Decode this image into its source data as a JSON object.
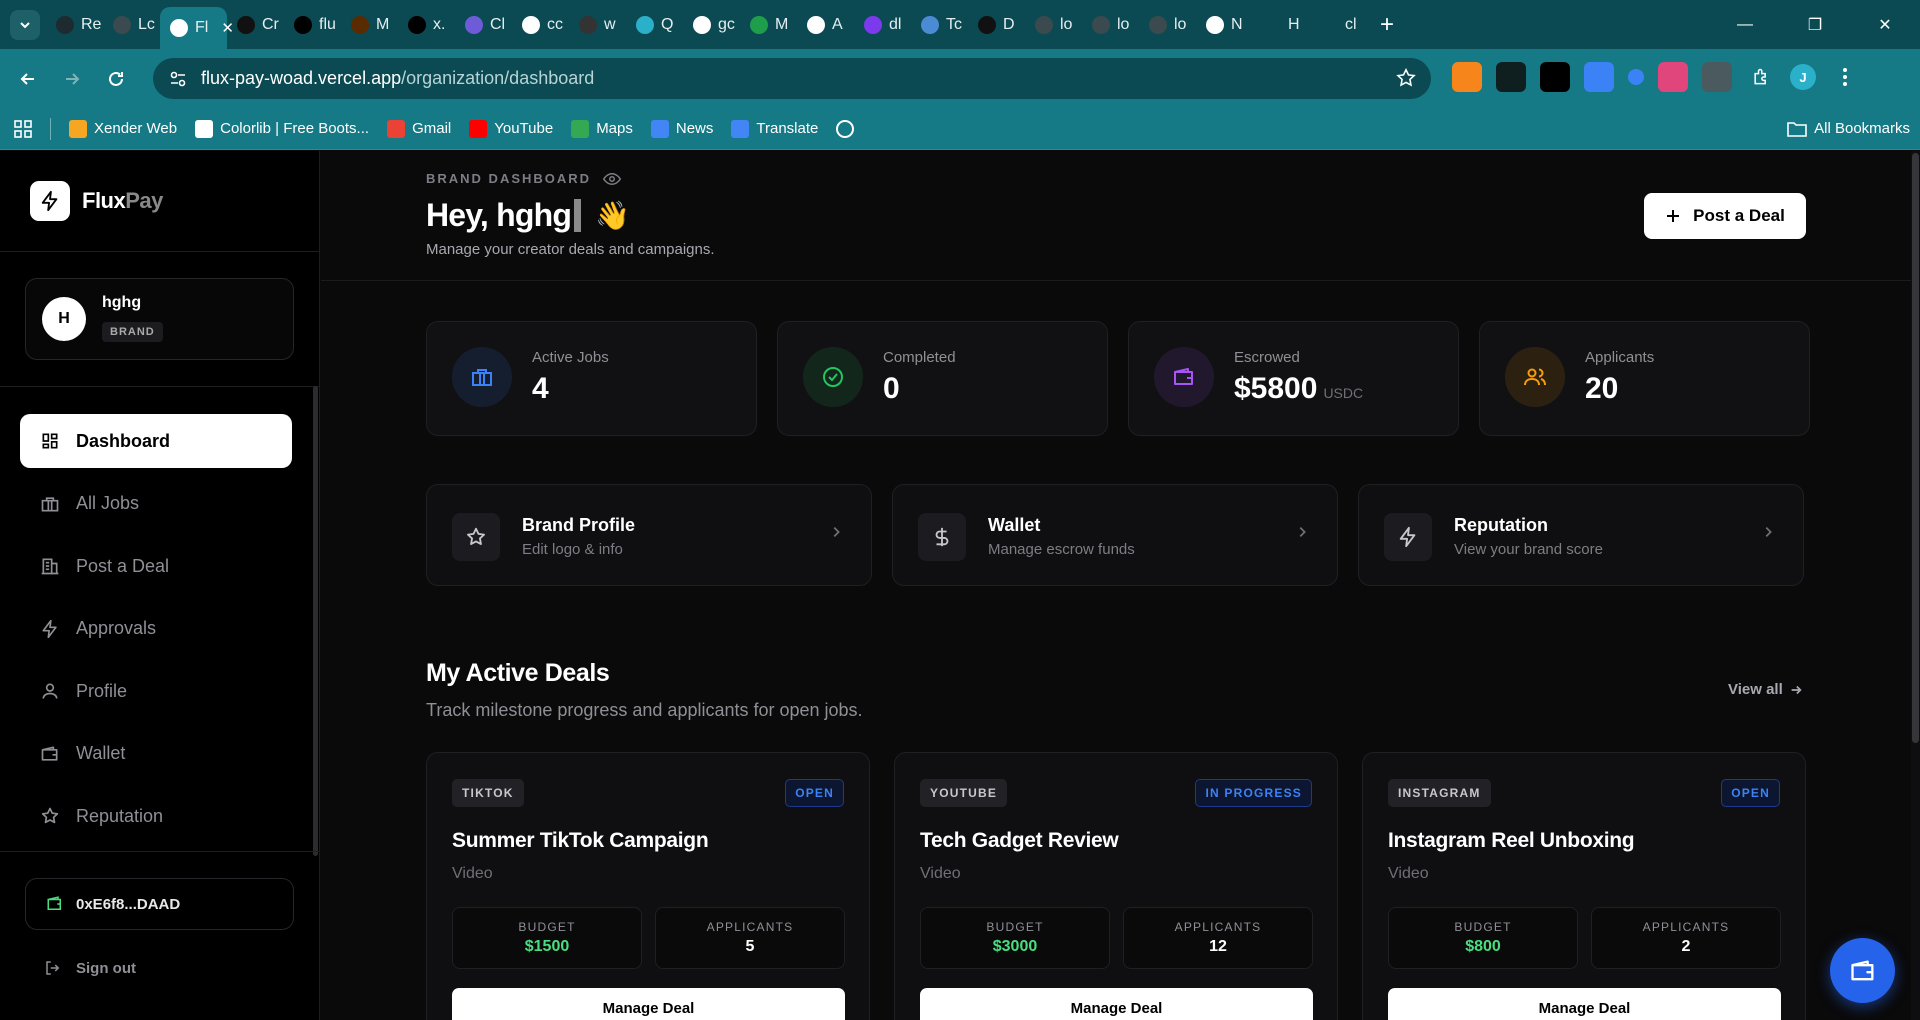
{
  "browser": {
    "tabs": [
      {
        "label": "Re",
        "icon": "react-icon",
        "color": "#1d2b30"
      },
      {
        "label": "Lc",
        "icon": "globe-icon",
        "color": "#3a4a4e"
      },
      {
        "label": "Fl",
        "icon": "flux-icon",
        "color": "#ffffff",
        "active": true
      },
      {
        "label": "Cr",
        "icon": "github-icon",
        "color": "#111111"
      },
      {
        "label": "flu",
        "icon": "vercel-icon",
        "color": "#000000"
      },
      {
        "label": "M",
        "icon": "metamask-icon",
        "color": "#5a2a00"
      },
      {
        "label": "x.",
        "icon": "x-icon",
        "color": "#000000"
      },
      {
        "label": "Cl",
        "icon": "claude-icon",
        "color": "#6e5bd8"
      },
      {
        "label": "cc",
        "icon": "notion-icon",
        "color": "#ffffff"
      },
      {
        "label": "w",
        "icon": "camera-icon",
        "color": "#333333"
      },
      {
        "label": "Q",
        "icon": "q-icon",
        "color": "#2bb0c9"
      },
      {
        "label": "gc",
        "icon": "gemini-icon",
        "color": "#ffffff"
      },
      {
        "label": "M",
        "icon": "meet-icon",
        "color": "#1e9e4a"
      },
      {
        "label": "A",
        "icon": "a-icon",
        "color": "#ffffff"
      },
      {
        "label": "dl",
        "icon": "d-icon",
        "color": "#7c3aed"
      },
      {
        "label": "Tc",
        "icon": "t-icon",
        "color": "#4b8bd4"
      },
      {
        "label": "D",
        "icon": "github-icon",
        "color": "#111111"
      },
      {
        "label": "lo",
        "icon": "globe-icon",
        "color": "#3a4a4e"
      },
      {
        "label": "lo",
        "icon": "globe-icon",
        "color": "#3a4a4e"
      },
      {
        "label": "lo",
        "icon": "globe-icon",
        "color": "#3a4a4e"
      },
      {
        "label": "N",
        "icon": "chrome-icon",
        "color": "#ffffff"
      },
      {
        "label": "H",
        "icon": "history-icon",
        "color": "#0b4a52"
      },
      {
        "label": "cl",
        "icon": "claude-spark-icon",
        "color": "#0b4a52"
      }
    ],
    "close_tab": "✕",
    "new_tab": "+",
    "window_controls": {
      "minimize": "—",
      "restore": "❐",
      "close": "✕"
    },
    "url_host": "flux-pay-woad.vercel.app",
    "url_path": "/organization/dashboard",
    "extensions": [
      "metamask-icon",
      "terminal-icon",
      "x-icon",
      "cloud-icon",
      "circle-icon",
      "figma-icon",
      "bot-icon",
      "puzzle-icon",
      "profile-icon",
      "menu-icon"
    ],
    "profile_initial": "J",
    "bookmarks": [
      {
        "label": "Xender Web",
        "icon": "xender-icon",
        "color": "#f5a623"
      },
      {
        "label": "Colorlib | Free Boots...",
        "icon": "globe-icon",
        "color": "#ffffff"
      },
      {
        "label": "Gmail",
        "icon": "gmail-icon",
        "color": "#ea4335"
      },
      {
        "label": "YouTube",
        "icon": "youtube-icon",
        "color": "#ff0000"
      },
      {
        "label": "Maps",
        "icon": "maps-icon",
        "color": "#34a853"
      },
      {
        "label": "News",
        "icon": "news-icon",
        "color": "#4285f4"
      },
      {
        "label": "Translate",
        "icon": "translate-icon",
        "color": "#4285f4"
      }
    ],
    "all_bookmarks": "All Bookmarks"
  },
  "sidebar": {
    "logo_flux": "Flux",
    "logo_pay": "Pay",
    "user_initial": "H",
    "user_name": "hghg",
    "user_role": "BRAND",
    "items": [
      {
        "label": "Dashboard",
        "icon": "dashboard-icon",
        "active": true
      },
      {
        "label": "All Jobs",
        "icon": "briefcase-icon"
      },
      {
        "label": "Post a Deal",
        "icon": "building-icon"
      },
      {
        "label": "Approvals",
        "icon": "bolt-icon"
      },
      {
        "label": "Profile",
        "icon": "user-icon"
      },
      {
        "label": "Wallet",
        "icon": "wallet-icon"
      },
      {
        "label": "Reputation",
        "icon": "star-icon"
      }
    ],
    "wallet_address": "0xE6f8...DAAD",
    "sign_out": "Sign out"
  },
  "header": {
    "eyebrow": "BRAND DASHBOARD",
    "greeting": "Hey, hghg",
    "wave": "👋",
    "subtitle": "Manage your creator deals and campaigns.",
    "post_button": "Post a Deal"
  },
  "stats": [
    {
      "label": "Active Jobs",
      "value": "4",
      "unit": "",
      "icon": "briefcase-icon",
      "color": "#3b82f6"
    },
    {
      "label": "Completed",
      "value": "0",
      "unit": "",
      "icon": "check-circle-icon",
      "color": "#22c55e"
    },
    {
      "label": "Escrowed",
      "value": "$5800",
      "unit": "USDC",
      "icon": "wallet-icon",
      "color": "#a855f7"
    },
    {
      "label": "Applicants",
      "value": "20",
      "unit": "",
      "icon": "users-icon",
      "color": "#f59e0b"
    }
  ],
  "quick_links": [
    {
      "title": "Brand Profile",
      "subtitle": "Edit logo & info",
      "icon": "star-icon"
    },
    {
      "title": "Wallet",
      "subtitle": "Manage escrow funds",
      "icon": "dollar-icon"
    },
    {
      "title": "Reputation",
      "subtitle": "View your brand score",
      "icon": "bolt-icon"
    }
  ],
  "deals_section": {
    "title": "My Active Deals",
    "subtitle": "Track milestone progress and applicants for open jobs.",
    "view_all": "View all"
  },
  "deals": [
    {
      "platform": "TIKTOK",
      "status": "OPEN",
      "title": "Summer TikTok Campaign",
      "type": "Video",
      "budget_label": "BUDGET",
      "budget": "$1500",
      "applicants_label": "APPLICANTS",
      "applicants": "5",
      "action": "Manage Deal"
    },
    {
      "platform": "YOUTUBE",
      "status": "IN PROGRESS",
      "title": "Tech Gadget Review",
      "type": "Video",
      "budget_label": "BUDGET",
      "budget": "$3000",
      "applicants_label": "APPLICANTS",
      "applicants": "12",
      "action": "Manage Deal"
    },
    {
      "platform": "INSTAGRAM",
      "status": "OPEN",
      "title": "Instagram Reel Unboxing",
      "type": "Video",
      "budget_label": "BUDGET",
      "budget": "$800",
      "applicants_label": "APPLICANTS",
      "applicants": "2",
      "action": "Manage Deal"
    }
  ]
}
